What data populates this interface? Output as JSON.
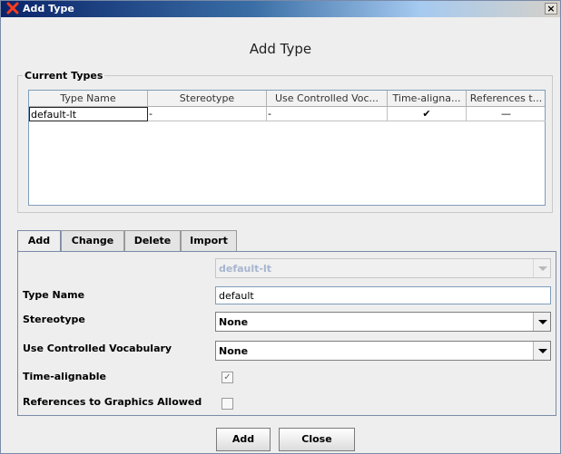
{
  "window": {
    "title": "Add Type",
    "close_symbol": "×"
  },
  "header": {
    "title": "Add Type"
  },
  "current_types": {
    "group_title": "Current Types",
    "columns": [
      "Type Name",
      "Stereotype",
      "Use Controlled Voc...",
      "Time-aligna...",
      "References t..."
    ],
    "rows": [
      {
        "type_name": "default-lt",
        "stereotype": "-",
        "controlled_vocabulary": "-",
        "time_alignable": "✔",
        "references": "—"
      }
    ]
  },
  "tabs": [
    {
      "label": "Add",
      "active": true
    },
    {
      "label": "Change",
      "active": false
    },
    {
      "label": "Delete",
      "active": false
    },
    {
      "label": "Import",
      "active": false
    }
  ],
  "form": {
    "type_select": {
      "value": "default-lt",
      "disabled": true
    },
    "type_name": {
      "label": "Type Name",
      "value": "default"
    },
    "stereotype": {
      "label": "Stereotype",
      "value": "None"
    },
    "controlled_vocabulary": {
      "label": "Use Controlled Vocabulary",
      "value": "None"
    },
    "time_alignable": {
      "label": "Time-alignable",
      "checked": true,
      "disabled": true,
      "mark": "✓"
    },
    "graphic_references": {
      "label": "References to Graphics Allowed",
      "checked": false
    }
  },
  "buttons": {
    "add": "Add",
    "close": "Close"
  },
  "colors": {
    "title_bar_start": "#0a246a",
    "disabled_text": "#a7b5d0"
  },
  "icons": {
    "app": "elan-x-icon",
    "close": "close-icon",
    "dropdown": "chevron-down-icon"
  }
}
